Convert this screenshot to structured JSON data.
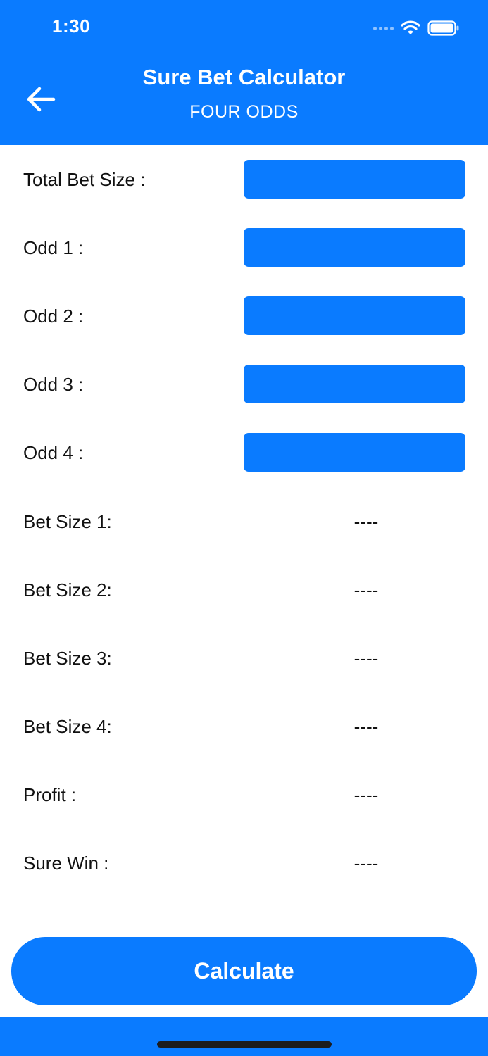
{
  "status_bar": {
    "time": "1:30"
  },
  "header": {
    "title": "Sure Bet Calculator",
    "subtitle": "FOUR ODDS"
  },
  "inputs": [
    {
      "label": "Total Bet Size :",
      "value": ""
    },
    {
      "label": "Odd 1 :",
      "value": ""
    },
    {
      "label": "Odd 2 :",
      "value": ""
    },
    {
      "label": "Odd 3 :",
      "value": ""
    },
    {
      "label": "Odd 4 :",
      "value": ""
    }
  ],
  "results": [
    {
      "label": "Bet Size 1:",
      "value": "----"
    },
    {
      "label": "Bet Size 2:",
      "value": "----"
    },
    {
      "label": "Bet Size 3:",
      "value": "----"
    },
    {
      "label": "Bet Size 4:",
      "value": "----"
    },
    {
      "label": "Profit :",
      "value": "----"
    },
    {
      "label": "Sure Win :",
      "value": "----"
    }
  ],
  "calculate_label": "Calculate",
  "colors": {
    "accent": "#0a7bff",
    "text": "#111111",
    "background": "#ffffff"
  }
}
